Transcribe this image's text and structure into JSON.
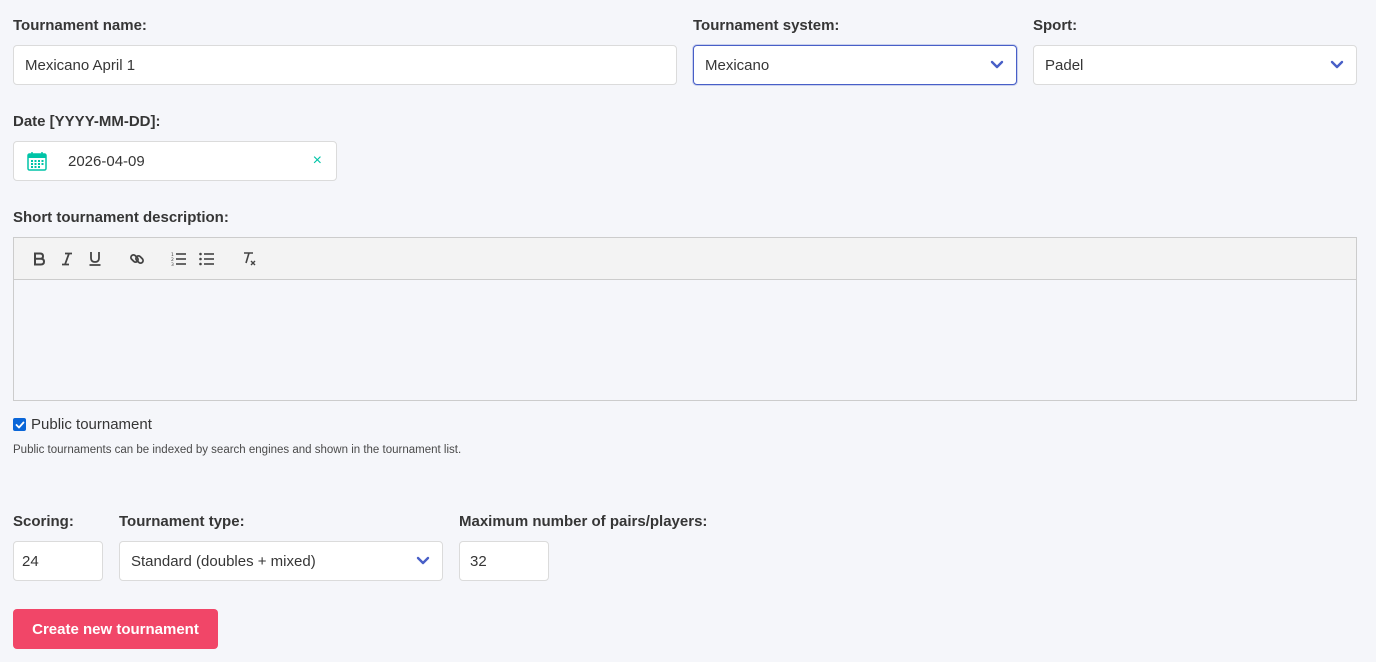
{
  "tournament_name": {
    "label": "Tournament name:",
    "value": "Mexicano April 1"
  },
  "tournament_system": {
    "label": "Tournament system:",
    "value": "Mexicano"
  },
  "sport": {
    "label": "Sport:",
    "value": "Padel"
  },
  "date": {
    "label": "Date [YYYY-MM-DD]:",
    "value": "2026-04-09",
    "clear_icon": "×"
  },
  "description": {
    "label": "Short tournament description:",
    "toolbar": [
      "bold-icon",
      "italic-icon",
      "underline-icon",
      "link-icon",
      "ordered-list-icon",
      "bullet-list-icon",
      "clear-format-icon"
    ],
    "content": ""
  },
  "public": {
    "checked": true,
    "label": "Public tournament",
    "help": "Public tournaments can be indexed by search engines and shown in the tournament list."
  },
  "scoring": {
    "label": "Scoring:",
    "value": "24"
  },
  "tournament_type": {
    "label": "Tournament type:",
    "value": "Standard (doubles + mixed)"
  },
  "max_players": {
    "label": "Maximum number of pairs/players:",
    "value": "32"
  },
  "submit": {
    "label": "Create new tournament"
  },
  "colors": {
    "accent": "#485fc7",
    "button": "#f14668",
    "date_icon": "#00c4a7"
  }
}
